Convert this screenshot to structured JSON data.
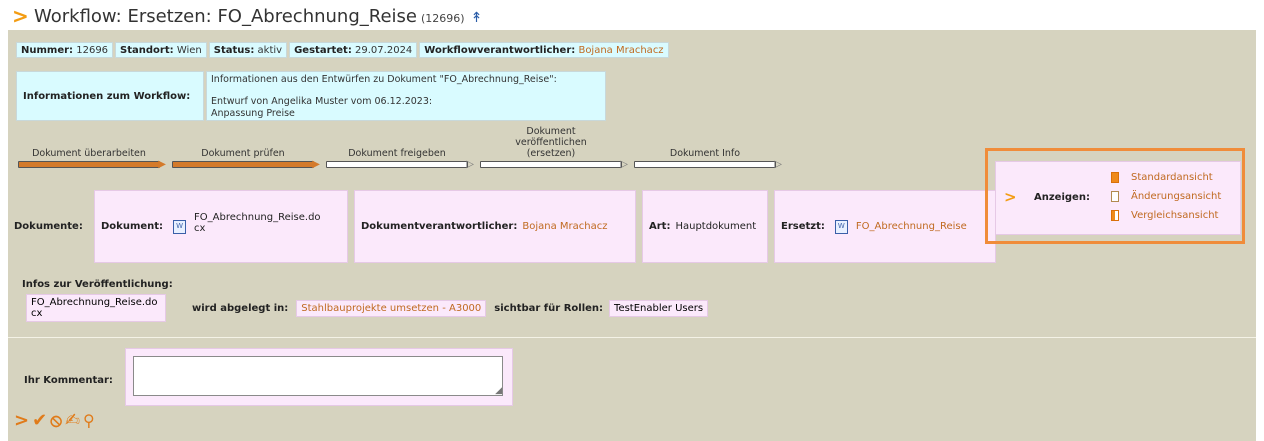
{
  "header": {
    "title": "Workflow: Ersetzen: FO_Abrechnung_Reise",
    "id": "(12696)",
    "up_icon": "↟"
  },
  "meta": {
    "nummer_label": "Nummer:",
    "nummer": "12696",
    "standort_label": "Standort:",
    "standort": "Wien",
    "status_label": "Status:",
    "status": "aktiv",
    "gestartet_label": "Gestartet:",
    "gestartet": "29.07.2024",
    "verantwortlicher_label": "Workflowverantwortlicher:",
    "verantwortlicher": "Bojana Mrachacz"
  },
  "info": {
    "label": "Informationen zum Workflow:",
    "line1": "Informationen aus den Entwürfen zu Dokument \"FO_Abrechnung_Reise\":",
    "line2": "Entwurf von Angelika Muster vom 06.12.2023:",
    "line3": "Anpassung Preise"
  },
  "steps": [
    {
      "label": "Dokument überarbeiten",
      "state": "done"
    },
    {
      "label": "Dokument prüfen",
      "state": "done"
    },
    {
      "label": "Dokument freigeben",
      "state": "todo"
    },
    {
      "label": "Dokument veröffentlichen (ersetzen)",
      "state": "todo"
    },
    {
      "label": "Dokument Info",
      "state": "todo"
    }
  ],
  "documents": {
    "label": "Dokumente:",
    "doc_label": "Dokument:",
    "doc_file_1": "FO_Abrechnung_Reise.do",
    "doc_file_2": "cx",
    "owner_label": "Dokumentverantwortlicher:",
    "owner": "Bojana Mrachacz",
    "art_label": "Art:",
    "art": "Hauptdokument",
    "ersetzt_label": "Ersetzt:",
    "ersetzt": "FO_Abrechnung_Reise"
  },
  "anzeigen": {
    "label": "Anzeigen:",
    "options": [
      "Standardansicht",
      "Änderungsansicht",
      "Vergleichsansicht"
    ]
  },
  "publication": {
    "title": "Infos zur Veröffentlichung:",
    "file_1": "FO_Abrechnung_Reise.do",
    "file_2": "cx",
    "stored_label": "wird abgelegt in:",
    "stored": "Stahlbauprojekte umsetzen - A3000",
    "roles_label": "sichtbar für Rollen:",
    "roles": "TestEnabler Users"
  },
  "comment": {
    "label": "Ihr Kommentar:",
    "value": ""
  },
  "actions": [
    "arrow-right-icon",
    "checkmark-icon",
    "cancel-icon",
    "sign-icon",
    "search-icon"
  ],
  "colors": {
    "accent": "#f39c12",
    "highlight_frame": "#f08c3a",
    "panel": "#d6d3bf",
    "info_bg": "#d9fbff",
    "doc_bg": "#fbe9fb",
    "link_orange": "#c06a20"
  }
}
